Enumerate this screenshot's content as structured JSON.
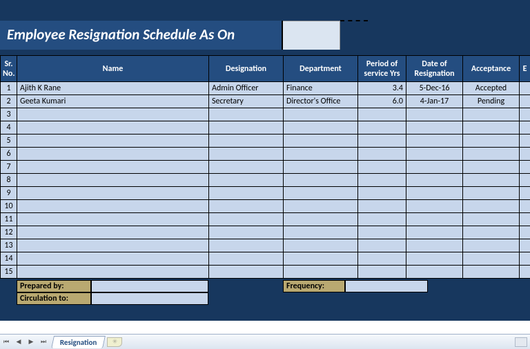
{
  "title": "Employee Resignation Schedule As On",
  "title_date": "",
  "columns": [
    "Sr. No.",
    "Name",
    "Designation",
    "Department",
    "Period of service Yrs",
    "Date of Resignation",
    "Acceptance",
    "E"
  ],
  "rows": [
    {
      "sr": "1",
      "name": "Ajith K Rane",
      "designation": "Admin Officer",
      "department": "Finance",
      "period": "3.4",
      "resdate": "5-Dec-16",
      "acceptance": "Accepted"
    },
    {
      "sr": "2",
      "name": "Geeta Kumari",
      "designation": "Secretary",
      "department": "Director's Office",
      "period": "6.0",
      "resdate": "4-Jan-17",
      "acceptance": "Pending"
    },
    {
      "sr": "3",
      "name": "",
      "designation": "",
      "department": "",
      "period": "",
      "resdate": "",
      "acceptance": ""
    },
    {
      "sr": "4",
      "name": "",
      "designation": "",
      "department": "",
      "period": "",
      "resdate": "",
      "acceptance": ""
    },
    {
      "sr": "5",
      "name": "",
      "designation": "",
      "department": "",
      "period": "",
      "resdate": "",
      "acceptance": ""
    },
    {
      "sr": "6",
      "name": "",
      "designation": "",
      "department": "",
      "period": "",
      "resdate": "",
      "acceptance": ""
    },
    {
      "sr": "7",
      "name": "",
      "designation": "",
      "department": "",
      "period": "",
      "resdate": "",
      "acceptance": ""
    },
    {
      "sr": "8",
      "name": "",
      "designation": "",
      "department": "",
      "period": "",
      "resdate": "",
      "acceptance": ""
    },
    {
      "sr": "9",
      "name": "",
      "designation": "",
      "department": "",
      "period": "",
      "resdate": "",
      "acceptance": ""
    },
    {
      "sr": "10",
      "name": "",
      "designation": "",
      "department": "",
      "period": "",
      "resdate": "",
      "acceptance": ""
    },
    {
      "sr": "11",
      "name": "",
      "designation": "",
      "department": "",
      "period": "",
      "resdate": "",
      "acceptance": ""
    },
    {
      "sr": "12",
      "name": "",
      "designation": "",
      "department": "",
      "period": "",
      "resdate": "",
      "acceptance": ""
    },
    {
      "sr": "13",
      "name": "",
      "designation": "",
      "department": "",
      "period": "",
      "resdate": "",
      "acceptance": ""
    },
    {
      "sr": "14",
      "name": "",
      "designation": "",
      "department": "",
      "period": "",
      "resdate": "",
      "acceptance": ""
    },
    {
      "sr": "15",
      "name": "",
      "designation": "",
      "department": "",
      "period": "",
      "resdate": "",
      "acceptance": ""
    }
  ],
  "footer": {
    "prepared_by_label": "Prepared by:",
    "prepared_by_value": "",
    "circulation_to_label": "Circulation to:",
    "circulation_to_value": "",
    "frequency_label": "Frequency:",
    "frequency_value": ""
  },
  "tabs": {
    "active": "Resignation",
    "nav_first": "⏮",
    "nav_prev": "◀",
    "nav_next": "▶",
    "nav_last": "⏭",
    "new_tab": "✳"
  }
}
